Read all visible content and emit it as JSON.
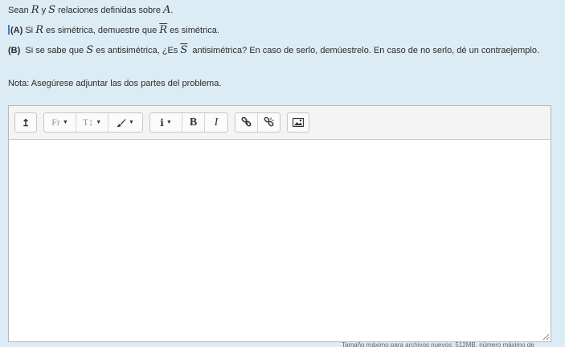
{
  "question": {
    "line1": {
      "p1": "Sean ",
      "R": "R",
      "p2": " y ",
      "S": "S",
      "p3": " relaciones definidas sobre ",
      "A": "A",
      "p4": "."
    },
    "partA": {
      "label": "(A)",
      "p1": " Si ",
      "R": "R",
      "p2": " es simétrica, demuestre que ",
      "Rbar": "R",
      "p3": " es simétrica."
    },
    "partB": {
      "label": "(B)",
      "p1": "  Si se sabe que ",
      "S": "S",
      "p2": " es antisimétrica, ¿Es ",
      "Sbar": "S",
      "p3": "  antisimétrica? En caso de serlo, demúestrelo. En caso de no serlo, dé un contraejemplo."
    },
    "note": "Nota: Asegúrese adjuntar las dos partes del problema."
  },
  "toolbar": {
    "collapse_glyph": "↥",
    "font_label": "Fr",
    "size_label": "T↕",
    "style_glyph": "✎",
    "info_glyph": "i",
    "bold_label": "B",
    "italic_label": "I",
    "caret": "▼"
  },
  "footer": {
    "text": "Tamaño máximo para archivos nuevos: 512MB, número máximo de"
  },
  "colors": {
    "background": "#dcecf4",
    "toolbar_bg": "#f4f4f4",
    "editor_border": "#b7b7b7"
  },
  "icons": [
    "collapse-icon",
    "font-icon",
    "text-size-icon",
    "brush-icon",
    "info-icon",
    "link-icon",
    "unlink-icon",
    "image-icon",
    "resize-grip-icon"
  ]
}
